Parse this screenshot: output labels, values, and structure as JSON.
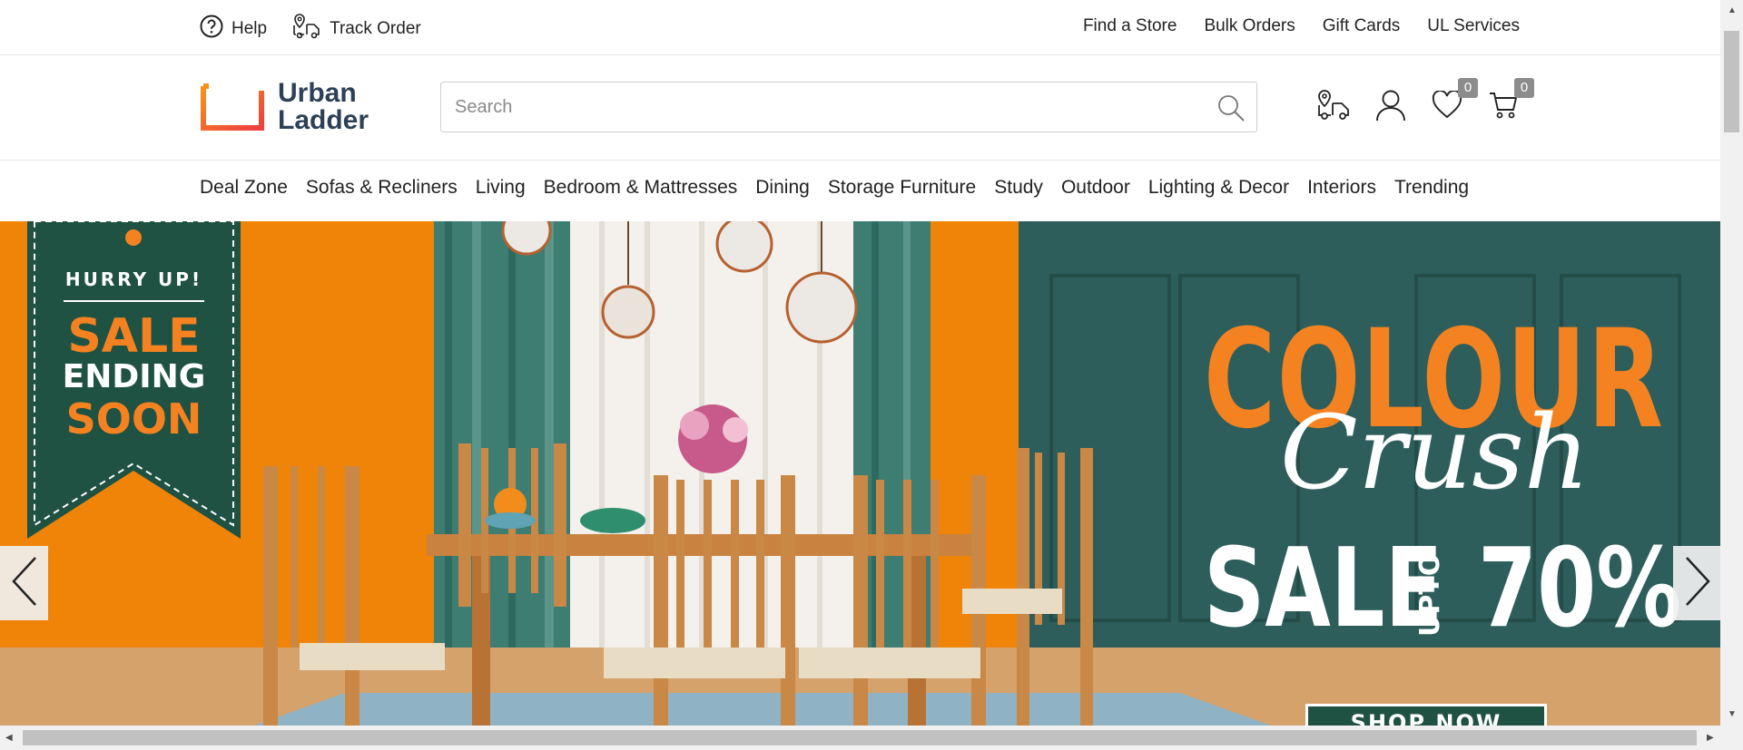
{
  "topbar": {
    "help": "Help",
    "track_order": "Track Order",
    "links": [
      "Find a Store",
      "Bulk Orders",
      "Gift Cards",
      "UL Services"
    ]
  },
  "brand": {
    "line1": "Urban",
    "line2": "Ladder",
    "accent": "#f15a24"
  },
  "search": {
    "placeholder": "Search",
    "value": ""
  },
  "header_icons": {
    "delivery": "truck-location-icon",
    "account": "user-icon",
    "wishlist_count": "0",
    "cart_count": "0"
  },
  "nav": [
    "Deal Zone",
    "Sofas & Recliners",
    "Living",
    "Bedroom & Mattresses",
    "Dining",
    "Storage Furniture",
    "Study",
    "Outdoor",
    "Lighting & Decor",
    "Interiors",
    "Trending"
  ],
  "hero": {
    "tag_line1": "HURRY UP!",
    "tag_line2": "SALE",
    "tag_line3": "ENDING",
    "tag_line4": "SOON",
    "headline": "COLOUR",
    "script": "Crush",
    "sale": "SALE",
    "upto": "UPTO",
    "percent": "70%",
    "cta": "SHOP NOW",
    "colors": {
      "orange": "#f58220",
      "teal": "#2e5e5b",
      "tag_green": "#1f5243"
    }
  }
}
